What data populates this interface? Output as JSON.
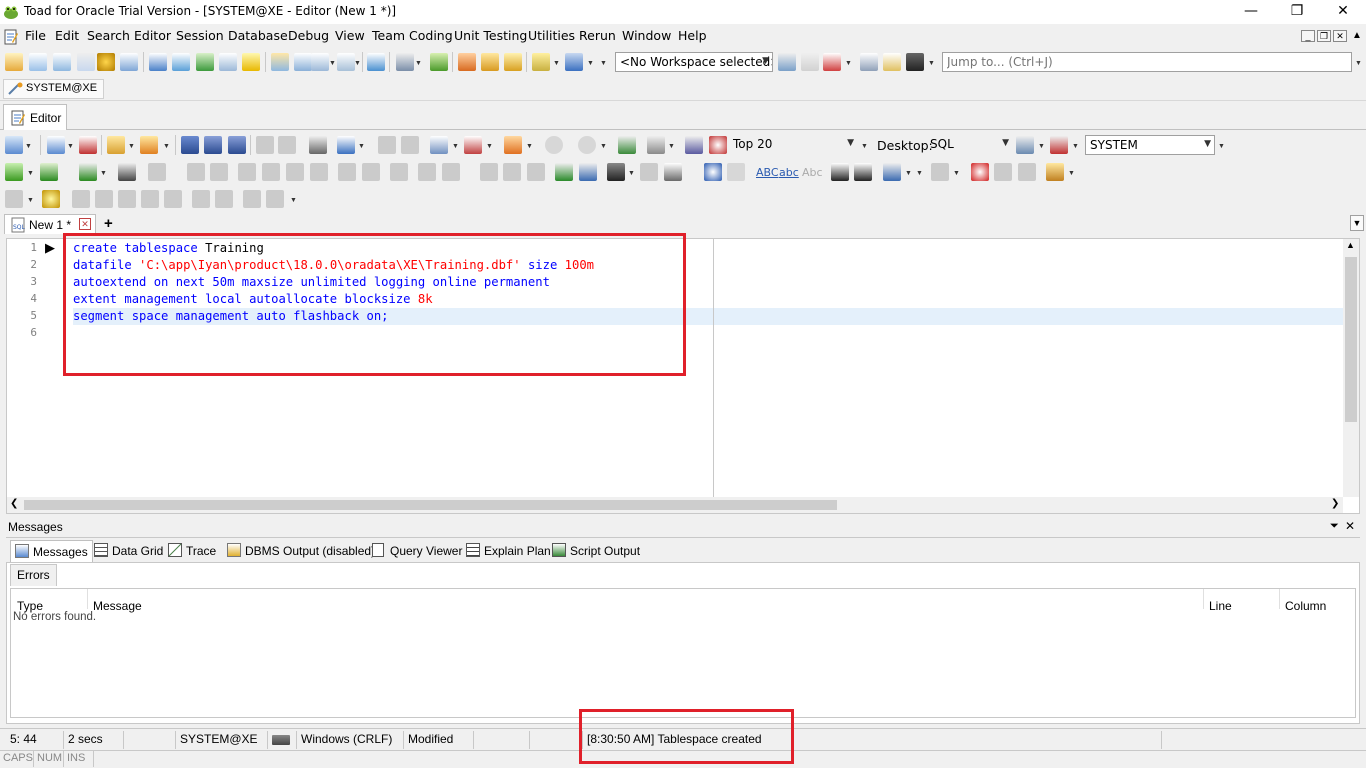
{
  "window": {
    "title": "Toad for Oracle Trial Version - [SYSTEM@XE - Editor (New 1 *)]"
  },
  "menu": [
    "File",
    "Edit",
    "Search",
    "Editor",
    "Session",
    "Database",
    "Debug",
    "View",
    "Team Coding",
    "Unit Testing",
    "Utilities",
    "Rerun",
    "Window",
    "Help"
  ],
  "toolbar": {
    "workspace": "<No Workspace selected>",
    "jump_placeholder": "Jump to... (Ctrl+J)",
    "top_rows": "Top 20",
    "desktop_label": "Desktop:",
    "desktop_value": "SQL",
    "schema": "SYSTEM"
  },
  "connection": {
    "tab": "SYSTEM@XE"
  },
  "editor_tab": {
    "label": "Editor"
  },
  "doc_tab": {
    "label": "New 1 *",
    "add": "+"
  },
  "code": {
    "line_numbers": [
      "1",
      "2",
      "3",
      "4",
      "5",
      "6"
    ],
    "line1": {
      "kw": "create tablespace",
      "ident": "Training"
    },
    "line2": {
      "kw": "datafile",
      "str": "'C:\\app\\Iyan\\product\\18.0.0\\oradata\\XE\\Training.dbf'",
      "kw2": "size",
      "num": "100m"
    },
    "line3": {
      "kw": "autoextend on next 50m maxsize unlimited logging online permanent"
    },
    "line4": {
      "kw": "extent management local autoallocate blocksize",
      "num": "8k"
    },
    "line5": {
      "kw": "segment space management auto flashback on;"
    }
  },
  "messages": {
    "title": "Messages",
    "tabs": [
      "Messages",
      "Data Grid",
      "Trace",
      "DBMS Output (disabled)",
      "Query Viewer",
      "Explain Plan",
      "Script Output"
    ],
    "subtab": "Errors",
    "columns": [
      "Type",
      "Message",
      "Line",
      "Column"
    ],
    "empty": "No errors found."
  },
  "status": {
    "position": "5: 44",
    "elapsed": "2 secs",
    "connection": "SYSTEM@XE",
    "line_ending": "Windows (CRLF)",
    "modified": "Modified",
    "message": "[8:30:50 AM]   Tablespace created",
    "caps": "CAPS",
    "num": "NUM",
    "ins": "INS"
  }
}
